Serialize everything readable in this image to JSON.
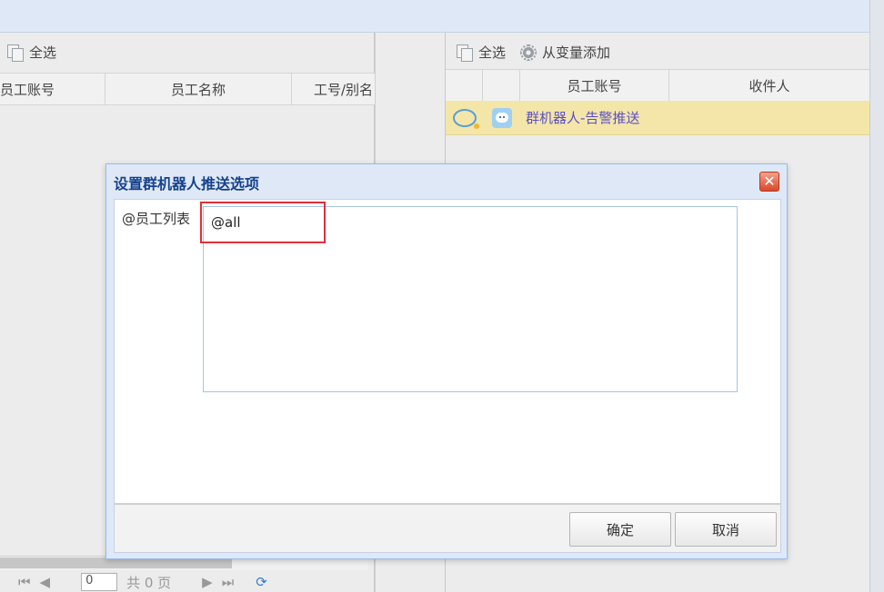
{
  "left_panel": {
    "toolbar": {
      "select_all": "全选"
    },
    "columns": [
      "员工账号",
      "员工名称",
      "工号/别名"
    ],
    "pager": {
      "page_value": "0",
      "total_text": "共 0 页"
    }
  },
  "right_panel": {
    "toolbar": {
      "select_all": "全选",
      "add_from_var": "从变量添加"
    },
    "columns": [
      "员工账号",
      "收件人"
    ],
    "rows": [
      {
        "account": "群机器人-告警推送",
        "chat_icon": "wechat-chat-icon",
        "robot_icon": "robot-icon"
      }
    ]
  },
  "dialog": {
    "title": "设置群机器人推送选项",
    "close_symbol": "✕",
    "field_label": "@员工列表",
    "textarea_value": "@all",
    "buttons": {
      "ok": "确定",
      "cancel": "取消"
    }
  },
  "colors": {
    "row_highlight": "#f4e6a9",
    "dialog_title": "#15428b",
    "annotation_box": "#e0303a",
    "link_text": "#5a4fc8"
  }
}
